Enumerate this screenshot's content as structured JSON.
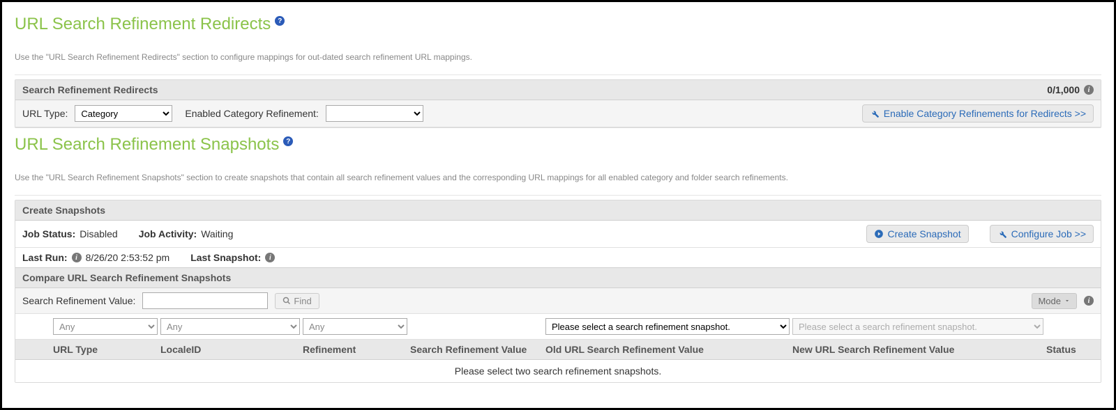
{
  "redirects": {
    "title": "URL Search Refinement Redirects",
    "description": "Use the \"URL Search Refinement Redirects\" section to configure mappings for out-dated search refinement URL mappings.",
    "panel_title": "Search Refinement Redirects",
    "count": "0/1,000",
    "url_type_label": "URL Type:",
    "url_type_value": "Category",
    "enabled_refinement_label": "Enabled Category Refinement:",
    "enable_button": "Enable Category Refinements for Redirects >>"
  },
  "snapshots": {
    "title": "URL Search Refinement Snapshots",
    "description": "Use the \"URL Search Refinement Snapshots\" section to create snapshots that contain all search refinement values and the corresponding URL mappings for all enabled category and folder search refinements.",
    "create_title": "Create Snapshots",
    "job_status_label": "Job Status:",
    "job_status_value": "Disabled",
    "job_activity_label": "Job Activity:",
    "job_activity_value": "Waiting",
    "last_run_label": "Last Run:",
    "last_run_value": "8/26/20 2:53:52 pm",
    "last_snapshot_label": "Last Snapshot:",
    "create_snapshot_btn": "Create Snapshot",
    "configure_job_btn": "Configure Job >>",
    "compare_title": "Compare URL Search Refinement Snapshots",
    "search_value_label": "Search Refinement Value:",
    "find_btn": "Find",
    "mode_btn": "Mode",
    "filters": {
      "any": "Any",
      "old_snapshot": "Please select a search refinement snapshot.",
      "new_snapshot": "Please select a search refinement snapshot."
    },
    "columns": {
      "url_type": "URL Type",
      "locale_id": "LocaleID",
      "refinement": "Refinement",
      "search_value": "Search Refinement Value",
      "old_value": "Old URL Search Refinement Value",
      "new_value": "New URL Search Refinement Value",
      "status": "Status"
    },
    "empty_msg": "Please select two search refinement snapshots."
  }
}
